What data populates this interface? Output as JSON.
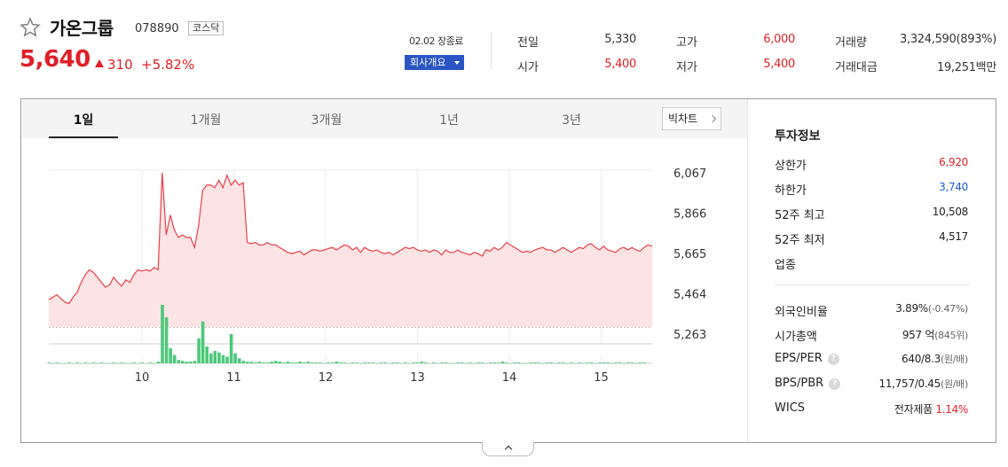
{
  "stock": {
    "name": "가온그룹",
    "code": "078890",
    "market": "코스닥",
    "price": "5,640",
    "change": "310",
    "change_rate": "+5.82%"
  },
  "status": {
    "label": "02.02 장종료",
    "company_button": "회사개요"
  },
  "quote": {
    "prev_label": "전일",
    "prev_value": "5,330",
    "open_label": "시가",
    "open_value": "5,400",
    "high_label": "고가",
    "high_value": "6,000",
    "low_label": "저가",
    "low_value": "5,400",
    "volume_label": "거래량",
    "volume_value": "3,324,590(893%)",
    "amount_label": "거래대금",
    "amount_value": "19,251백만"
  },
  "tabs": [
    "1일",
    "1개월",
    "3개월",
    "1년",
    "3년"
  ],
  "bigchart_label": "빅차트",
  "invest": {
    "title": "투자정보",
    "upper_label": "상한가",
    "upper_value": "6,920",
    "lower_label": "하한가",
    "lower_value": "3,740",
    "high52_label": "52주 최고",
    "high52_value": "10,508",
    "low52_label": "52주 최저",
    "low52_value": "4,517",
    "sector_label": "업종",
    "foreign_label": "외국인비율",
    "foreign_value": "3.89%",
    "foreign_sub": "(-0.47%)",
    "mktcap_label": "시가총액",
    "mktcap_value": "957 억",
    "mktcap_sub": "(845위)",
    "eps_label": "EPS/PER",
    "eps_value": "640/8.3",
    "eps_sub": "(원/배)",
    "bps_label": "BPS/PBR",
    "bps_value": "11,757/0.45",
    "bps_sub": "(원/배)",
    "wics_label": "WICS",
    "wics_value": "전자제품",
    "wics_rate": "1.14%"
  },
  "colors": {
    "up": "#e01f26",
    "down": "#1a5bc4",
    "volume": "#4cc97a",
    "line": "#e8404a"
  },
  "chart_data": {
    "type": "area",
    "ylim": [
      5263,
      6067
    ],
    "y_ticks": [
      "6,067",
      "5,866",
      "5,665",
      "5,464",
      "5,263"
    ],
    "x_ticks": [
      "10",
      "11",
      "12",
      "13",
      "14",
      "15"
    ],
    "baseline": 5330,
    "price": [
      5440,
      5450,
      5460,
      5445,
      5430,
      5425,
      5450,
      5470,
      5510,
      5540,
      5560,
      5550,
      5530,
      5510,
      5490,
      5500,
      5530,
      5510,
      5495,
      5520,
      5510,
      5540,
      5560,
      5555,
      5560,
      5555,
      5570,
      5560,
      5950,
      5700,
      5780,
      5720,
      5690,
      5700,
      5690,
      5690,
      5650,
      5740,
      5880,
      5900,
      5900,
      5890,
      5920,
      5890,
      5940,
      5900,
      5920,
      5900,
      5910,
      5670,
      5665,
      5670,
      5660,
      5660,
      5670,
      5660,
      5660,
      5650,
      5640,
      5630,
      5625,
      5630,
      5635,
      5620,
      5630,
      5640,
      5640,
      5635,
      5640,
      5645,
      5650,
      5640,
      5650,
      5660,
      5655,
      5640,
      5650,
      5630,
      5650,
      5640,
      5635,
      5640,
      5630,
      5625,
      5630,
      5620,
      5630,
      5640,
      5650,
      5645,
      5650,
      5640,
      5635,
      5640,
      5630,
      5640,
      5635,
      5620,
      5640,
      5630,
      5630,
      5640,
      5630,
      5625,
      5620,
      5630,
      5625,
      5615,
      5640,
      5635,
      5650,
      5640,
      5650,
      5670,
      5660,
      5650,
      5640,
      5630,
      5635,
      5630,
      5640,
      5645,
      5650,
      5640,
      5640,
      5630,
      5640,
      5650,
      5640,
      5630,
      5640,
      5650,
      5645,
      5660,
      5665,
      5650,
      5640,
      5655,
      5640,
      5635,
      5630,
      5645,
      5650,
      5640,
      5650,
      5640,
      5635,
      5650,
      5660,
      5655
    ],
    "volume": [
      1,
      0,
      1,
      0,
      0,
      1,
      0,
      1,
      0,
      1,
      0,
      1,
      0,
      1,
      0,
      0,
      1,
      0,
      1,
      0,
      0,
      1,
      0,
      1,
      0,
      1,
      0,
      2,
      70,
      55,
      18,
      10,
      4,
      3,
      2,
      2,
      3,
      30,
      50,
      20,
      12,
      15,
      13,
      10,
      8,
      35,
      12,
      6,
      3,
      2,
      2,
      1,
      2,
      1,
      1,
      2,
      3,
      2,
      1,
      2,
      1,
      1,
      2,
      1,
      2,
      1,
      1,
      1,
      0,
      1,
      1,
      2,
      1,
      1,
      0,
      1,
      1,
      0,
      1,
      1,
      1,
      0,
      1,
      1,
      0,
      1,
      1,
      0,
      1,
      0,
      1,
      1,
      2,
      1,
      0,
      1,
      0,
      1,
      1,
      0,
      0,
      1,
      1,
      0,
      1,
      0,
      1,
      1,
      0,
      1,
      1,
      1,
      2,
      1,
      0,
      1,
      1,
      0,
      0,
      1,
      1,
      1,
      0,
      1,
      1,
      0,
      1,
      1,
      0,
      1,
      0,
      1,
      0,
      1,
      1,
      0,
      1,
      1,
      1,
      0,
      1,
      1,
      0,
      1,
      1,
      0,
      1,
      1
    ]
  }
}
